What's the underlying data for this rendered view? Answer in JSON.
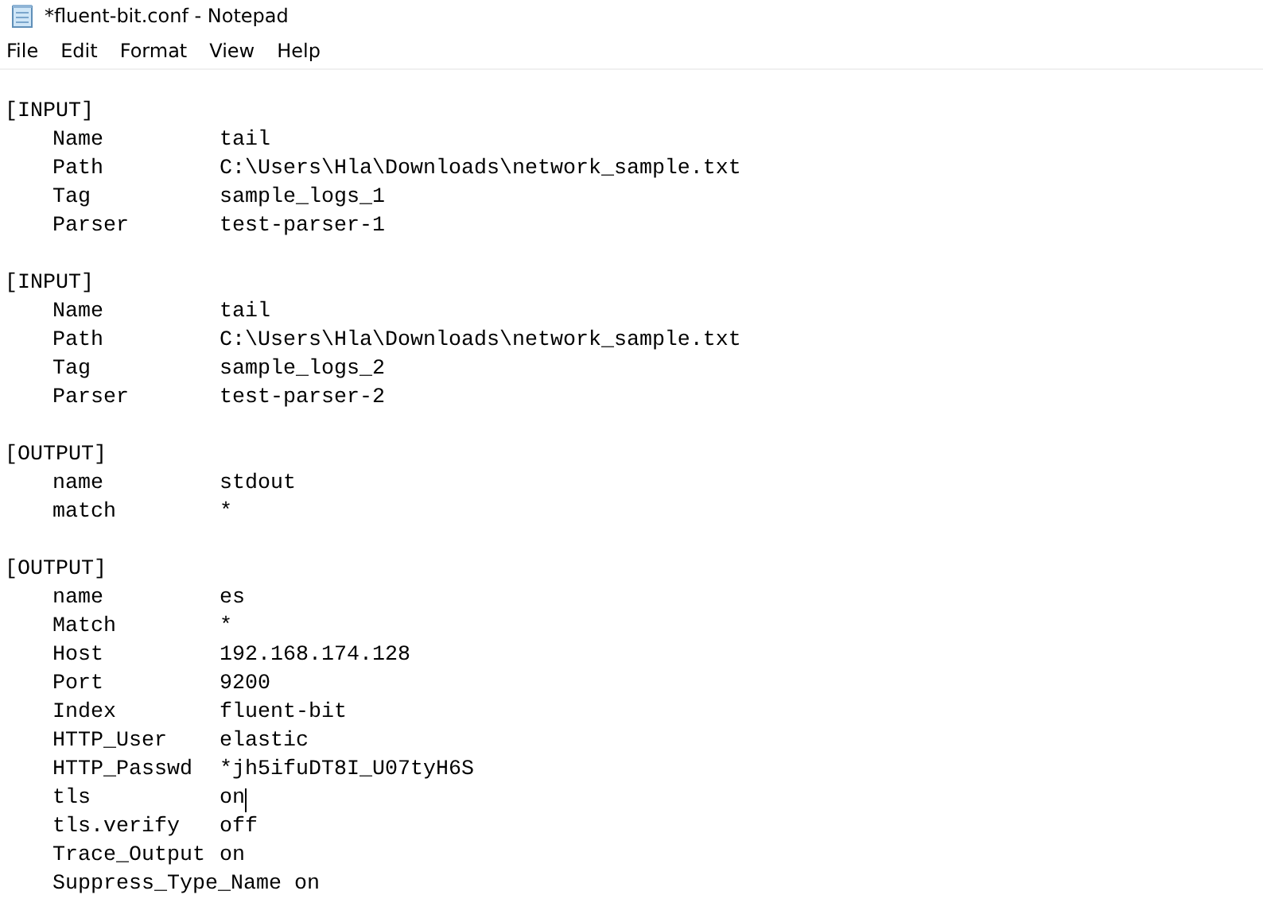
{
  "window": {
    "title": "*fluent-bit.conf - Notepad"
  },
  "menu": [
    "File",
    "Edit",
    "Format",
    "View",
    "Help"
  ],
  "sections": [
    {
      "header": "[INPUT]",
      "entries": [
        {
          "key": "Name",
          "value": "tail"
        },
        {
          "key": "Path",
          "value": "C:\\Users\\Hla\\Downloads\\network_sample.txt"
        },
        {
          "key": "Tag",
          "value": "sample_logs_1"
        },
        {
          "key": "Parser",
          "value": "test-parser-1"
        }
      ]
    },
    {
      "header": "[INPUT]",
      "entries": [
        {
          "key": "Name",
          "value": "tail"
        },
        {
          "key": "Path",
          "value": "C:\\Users\\Hla\\Downloads\\network_sample.txt"
        },
        {
          "key": "Tag",
          "value": "sample_logs_2"
        },
        {
          "key": "Parser",
          "value": "test-parser-2"
        }
      ]
    },
    {
      "header": "[OUTPUT]",
      "entries": [
        {
          "key": "name",
          "value": "stdout"
        },
        {
          "key": "match",
          "value": "*"
        }
      ]
    },
    {
      "header": "[OUTPUT]",
      "entries": [
        {
          "key": "name",
          "value": "es"
        },
        {
          "key": "Match",
          "value": "*"
        },
        {
          "key": "Host",
          "value": "192.168.174.128"
        },
        {
          "key": "Port",
          "value": "9200"
        },
        {
          "key": "Index",
          "value": "fluent-bit"
        },
        {
          "key": "HTTP_User",
          "value": "elastic"
        },
        {
          "key": "HTTP_Passwd",
          "value": "*jh5ifuDT8I_U07tyH6S"
        },
        {
          "key": "tls",
          "value": "on",
          "caret": true
        },
        {
          "key": "tls.verify",
          "value": "off"
        },
        {
          "key": "Trace_Output",
          "value": "on"
        },
        {
          "key": "Suppress_Type_Name",
          "value": "on"
        }
      ]
    }
  ]
}
